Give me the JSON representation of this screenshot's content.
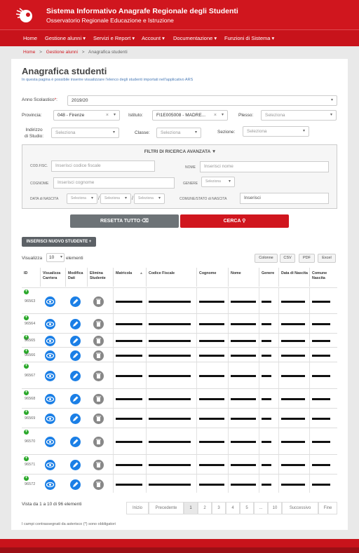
{
  "header": {
    "title": "Sistema Informativo Anagrafe Regionale degli Studenti",
    "subtitle": "Osservatorio Regionale Educazione e Istruzione",
    "brand_color": "#d0161e"
  },
  "nav": {
    "items": [
      "Home",
      "Gestione alunni ▾",
      "Servizi e Report ▾",
      "Account ▾",
      "Documentazione ▾",
      "Funzioni di Sistema ▾"
    ]
  },
  "breadcrumb": {
    "items": [
      "Home",
      ">",
      "Gestione alunni",
      ">",
      "Anagrafica studenti"
    ]
  },
  "page": {
    "title": "Anagrafica studenti",
    "description": "In questa pagina è possibile inserire visualizzare l'elenco degli studenti importati nell'applicativo ARS"
  },
  "filters": {
    "anno_label": "Anno Scolastico",
    "anno_required": "*",
    "anno_sep": ":",
    "anno_value": "2019/20",
    "provincia_label": "Provincia:",
    "provincia_value": "048 - Firenze",
    "istituto_label": "Istituto:",
    "istituto_value": "FI1E005008 - MADRE...",
    "plesso_label": "Plesso:",
    "plesso_placeholder": "Seleziona",
    "indirizzo_label_1": "Indirizzo",
    "indirizzo_label_2": "di Studio:",
    "indirizzo_placeholder": "Seleziona",
    "classe_label": "Classe:",
    "classe_placeholder": "Seleziona",
    "sezione_label": "Sezione:",
    "sezione_placeholder": "Seleziona"
  },
  "advanced": {
    "title": "FILTRI DI RICERCA AVANZATA",
    "codfisc_label": "COD.FISC.",
    "codfisc_placeholder": "Inserisci codice fiscale",
    "nome_label": "NOME",
    "nome_placeholder": "Inserisci nome",
    "cognome_label": "COGNOME",
    "cognome_placeholder": "Inserisci cognome",
    "genere_label": "GENERE",
    "genere_placeholder": "Seleziona",
    "data_label": "DATA di NASCITA",
    "data_day": "Seleziona",
    "data_month": "Seleziona",
    "data_year": "Seleziona",
    "slash": "/",
    "comune_label": "COMUNE/STATO di NASCITA",
    "comune_placeholder": "Inserisci"
  },
  "actions": {
    "reset_label": "RESETTA TUTTO",
    "search_label": "CERCA",
    "new_student_label": "INSERISCI NUOVO STUDENTE"
  },
  "table_controls": {
    "show_label": "Visualizza",
    "page_size": "10",
    "elements_label": "elementi",
    "exports": [
      "Colonne",
      "CSV",
      "PDF",
      "Excel"
    ]
  },
  "table": {
    "headers": [
      "ID",
      "Visualizza Carriera",
      "Modifica Dati",
      "Elimina Studente",
      "Matricola",
      "Codice Fiscale",
      "Cognome",
      "Nome",
      "Genere",
      "Data di Nascita",
      "Comune Nascita"
    ],
    "sort_indicator": "▲",
    "ids": [
      "96563",
      "96564",
      "96565",
      "96566",
      "96567",
      "96568",
      "96569",
      "96570",
      "96571",
      "96572"
    ]
  },
  "pagination": {
    "summary": "Vista da 1 a 10 di 96 elementi",
    "pages": [
      "Inizio",
      "Precedente",
      "1",
      "2",
      "3",
      "4",
      "5",
      "...",
      "10",
      "Successivo",
      "Fine"
    ],
    "current": "1"
  },
  "footnote": "I campi contrassegnati da asterisco (*) sono obbligatori"
}
